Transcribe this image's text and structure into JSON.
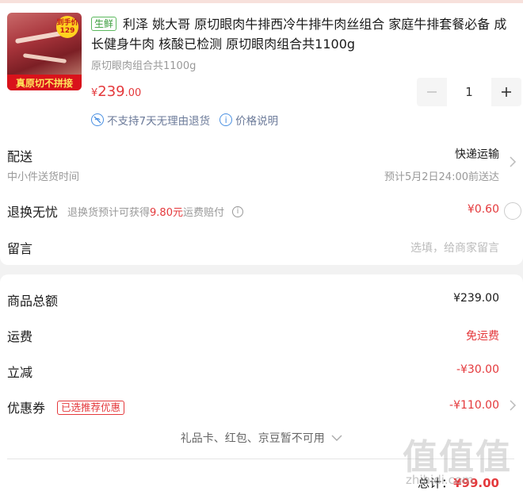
{
  "product": {
    "badge_text": "到手价 129",
    "ribbon_text": "真原切不拼接",
    "tag": "生鲜",
    "title": "利泽 姚大哥 原切眼肉牛排西冷牛排牛肉丝组合 家庭牛排套餐必备 成长健身牛肉 核酸已检测 原切眼肉组合共1100g",
    "spec": "原切眼肉组合共1100g",
    "price_symbol": "¥",
    "price_int": "239",
    "price_dec": ".00",
    "quantity": "1",
    "minus_icon": "minus-icon",
    "plus_icon": "plus-icon",
    "no_return_text": "不支持7天无理由退货",
    "price_info_text": "价格说明"
  },
  "delivery": {
    "label": "配送",
    "sub": "中小件送货时间",
    "method": "快递运输",
    "eta": "预计5月2日24:00前送达"
  },
  "return_insurance": {
    "label": "退换无忧",
    "desc_prefix": "退换货预计可获得",
    "desc_amount": "9.80元",
    "desc_suffix": "运费赔付",
    "price": "¥0.60"
  },
  "message": {
    "label": "留言",
    "placeholder": "选填，给商家留言"
  },
  "summary": {
    "total_label": "商品总额",
    "total_value": "¥239.00",
    "freight_label": "运费",
    "freight_value": "免运费",
    "discount_label": "立减",
    "discount_value": "-¥30.00",
    "coupon_label": "优惠券",
    "coupon_tag": "已选推荐优惠",
    "coupon_value": "-¥110.00",
    "gift_text": "礼品卡、红包、京豆暂不可用",
    "grand_label": "总计：",
    "grand_value": "¥99.00"
  },
  "watermark": {
    "text": "值值值",
    "url": "zhihidi.com"
  },
  "colors": {
    "accent_red": "#e4393c",
    "fresh_green": "#3a9c3c",
    "info_blue": "#4a90e2"
  }
}
